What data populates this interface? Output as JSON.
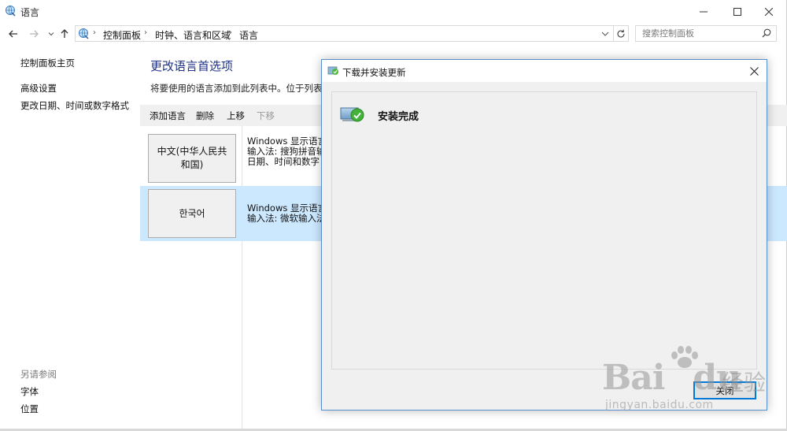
{
  "window": {
    "title": "语言",
    "icon": "globe-language-icon"
  },
  "address_bar": {
    "breadcrumbs": [
      "控制面板",
      "时钟、语言和区域",
      "语言"
    ]
  },
  "search": {
    "placeholder": "搜索控制面板"
  },
  "left_nav": {
    "home": "控制面板主页",
    "links": [
      "高级设置",
      "更改日期、时间或数字格式"
    ],
    "see_also_title": "另请参阅",
    "see_also": [
      "字体",
      "位置"
    ]
  },
  "main": {
    "heading": "更改语言首选项",
    "description": "将要使用的语言添加到此列表中。位于列表第一",
    "toolbar": {
      "add": "添加语言",
      "remove": "删除",
      "up": "上移",
      "down": "下移"
    },
    "languages": [
      {
        "name": "中文(中华人民共和国)",
        "lines": [
          "Windows 显示语言:",
          "输入法: 搜狗拼音输",
          "日期、时间和数字"
        ]
      },
      {
        "name": "한국어",
        "lines": [
          "Windows 显示语言:",
          "输入法: 微软输入法"
        ]
      }
    ]
  },
  "dialog": {
    "title": "下载并安装更新",
    "status": "安装完成",
    "close_button": "关闭"
  },
  "watermark": {
    "brand": "Bai",
    "brand2": "du",
    "cn": "经验",
    "url": "jingyan.baidu.com"
  },
  "colors": {
    "heading": "#1e3287",
    "selected_row": "#cce8ff",
    "focus_border": "#0078d7"
  }
}
